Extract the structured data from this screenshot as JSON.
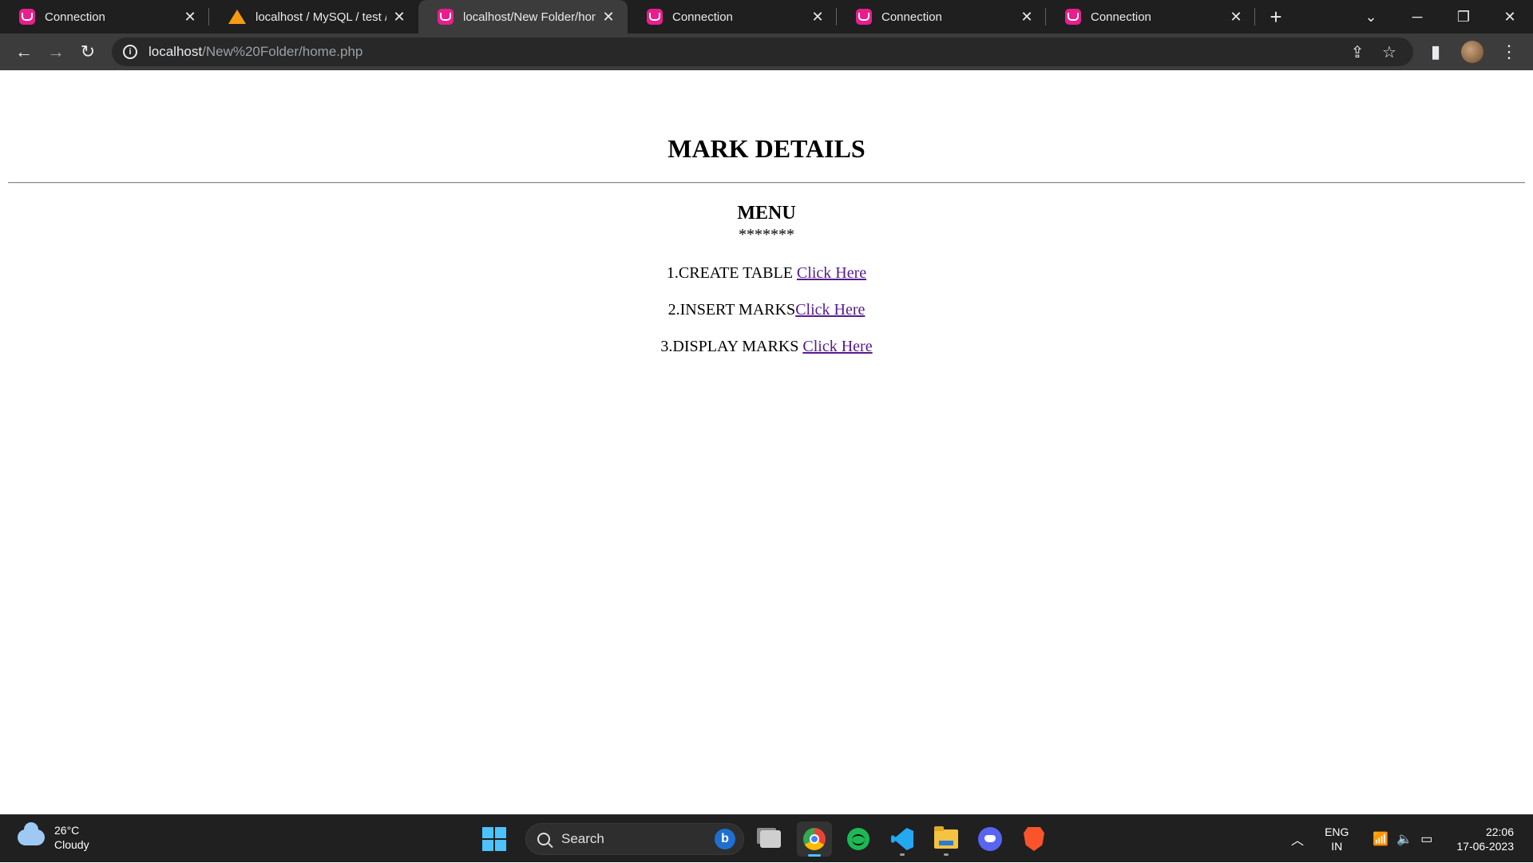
{
  "tabs": [
    {
      "title": "Connection",
      "icon": "wamp-icon",
      "active": false
    },
    {
      "title": "localhost / MySQL / test / m",
      "icon": "phpmyadmin-icon",
      "active": false
    },
    {
      "title": "localhost/New Folder/home",
      "icon": "wamp-icon",
      "active": true
    },
    {
      "title": "Connection",
      "icon": "wamp-icon",
      "active": false
    },
    {
      "title": "Connection",
      "icon": "wamp-icon",
      "active": false
    },
    {
      "title": "Connection",
      "icon": "wamp-icon",
      "active": false
    }
  ],
  "address": {
    "host": "localhost",
    "path": "/New%20Folder/home.php"
  },
  "page": {
    "heading": "MARK DETAILS",
    "menu_title": "MENU",
    "stars": "*******",
    "items": [
      {
        "label": "1.CREATE TABLE ",
        "link": "Click Here"
      },
      {
        "label": "2.INSERT MARKS",
        "link": "Click Here"
      },
      {
        "label": "3.DISPLAY MARKS ",
        "link": "Click Here"
      }
    ]
  },
  "taskbar": {
    "weather": {
      "temp": "26°C",
      "condition": "Cloudy"
    },
    "search_label": "Search",
    "apps": [
      "task-view-icon",
      "chrome-icon",
      "spotify-icon",
      "vscode-icon",
      "file-explorer-icon",
      "discord-icon",
      "brave-icon"
    ],
    "language": {
      "line1": "ENG",
      "line2": "IN"
    },
    "clock": {
      "time": "22:06",
      "date": "17-06-2023"
    }
  },
  "colors": {
    "link": "#551a8b",
    "tab_favicon": "#e91e8c",
    "windows_accent": "#4cc2ff"
  }
}
